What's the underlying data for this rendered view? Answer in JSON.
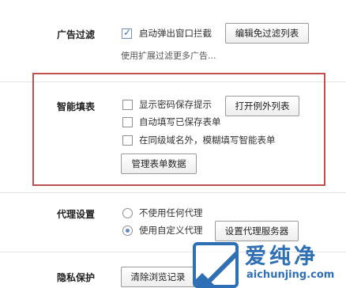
{
  "ad_filter": {
    "label": "广告过滤",
    "popup_block": {
      "label": "启动弹出窗口拦截",
      "checked": true
    },
    "edit_exempt_button": "编辑免过滤列表",
    "extension_hint": "使用扩展过滤更多广告..."
  },
  "smart_fill": {
    "label": "智能填表",
    "options": [
      {
        "label": "显示密码保存提示",
        "checked": false
      },
      {
        "label": "自动填写已保存表单",
        "checked": false
      },
      {
        "label": "在同级域名外，模糊填写智能表单",
        "checked": false
      }
    ],
    "open_exceptions_button": "打开例外列表",
    "manage_forms_button": "管理表单数据"
  },
  "proxy": {
    "label": "代理设置",
    "options": [
      {
        "label": "不使用任何代理",
        "selected": false
      },
      {
        "label": "使用自定义代理",
        "selected": true
      }
    ],
    "set_proxy_button": "设置代理服务器"
  },
  "privacy": {
    "label": "隐私保护",
    "clear_history_button": "清除浏览记录"
  },
  "watermark": {
    "title": "爱纯净",
    "url": "aichunjing.com"
  }
}
